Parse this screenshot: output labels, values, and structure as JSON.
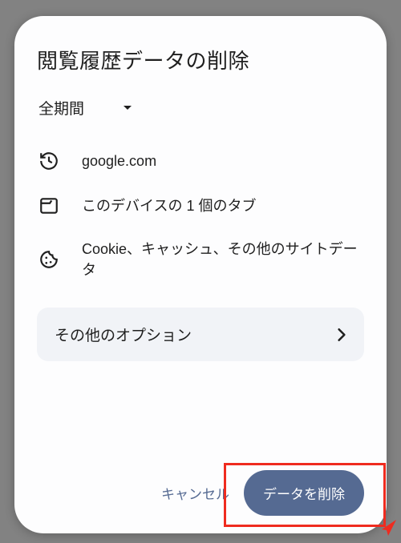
{
  "dialog": {
    "title": "閲覧履歴データの削除",
    "time_range": {
      "selected": "全期間"
    },
    "items": {
      "history": "google.com",
      "tabs": "このデバイスの 1 個のタブ",
      "cookies": "Cookie、キャッシュ、その他のサイトデータ"
    },
    "more_options_label": "その他のオプション",
    "buttons": {
      "cancel": "キャンセル",
      "confirm": "データを削除"
    }
  }
}
